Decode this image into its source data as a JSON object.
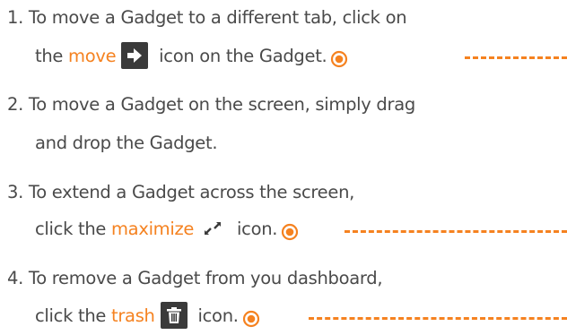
{
  "accent_color": "#f58220",
  "text_color": "#4a4a4a",
  "items": [
    {
      "line1": "1. To move a Gadget to a different tab, click on",
      "pre": "the ",
      "keyword": "move",
      "post": " icon on the Gadget.",
      "icon": "arrow-right-icon"
    },
    {
      "line1": "2. To move a Gadget on the screen, simply drag",
      "line2": "and drop the Gadget."
    },
    {
      "line1": "3. To extend a Gadget across the screen,",
      "pre": "click the ",
      "keyword": "maximize",
      "post": " icon.",
      "icon": "maximize-icon"
    },
    {
      "line1": "4. To remove a Gadget from you dashboard,",
      "pre": "click the ",
      "keyword": "trash",
      "post": " icon.",
      "icon": "trash-icon"
    }
  ]
}
